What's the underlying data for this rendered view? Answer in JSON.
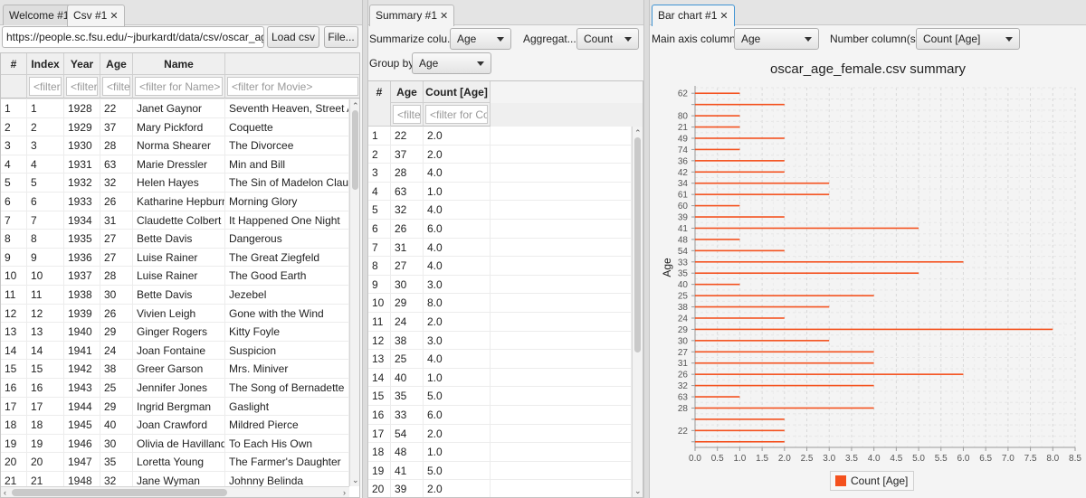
{
  "left": {
    "tabs": [
      {
        "label": "Welcome #1",
        "closable": false
      },
      {
        "label": "Csv #1",
        "closable": true
      }
    ],
    "url": "https://people.sc.fsu.edu/~jburkardt/data/csv/oscar_age_fer",
    "load_button": "Load csv",
    "file_button": "File...",
    "columns": [
      "#",
      "Index",
      "Year",
      "Age",
      "Name",
      ""
    ],
    "filters": [
      "",
      "<filter",
      "<filter",
      "<filte",
      "<filter for Name>",
      "<filter for Movie>"
    ],
    "rows": [
      [
        "1",
        "1",
        "1928",
        "22",
        "Janet Gaynor",
        "Seventh Heaven, Street Ang"
      ],
      [
        "2",
        "2",
        "1929",
        "37",
        "Mary Pickford",
        "Coquette"
      ],
      [
        "3",
        "3",
        "1930",
        "28",
        "Norma Shearer",
        "The Divorcee"
      ],
      [
        "4",
        "4",
        "1931",
        "63",
        "Marie Dressler",
        "Min and Bill"
      ],
      [
        "5",
        "5",
        "1932",
        "32",
        "Helen Hayes",
        "The Sin of Madelon Claudet"
      ],
      [
        "6",
        "6",
        "1933",
        "26",
        "Katharine Hepburn",
        "Morning Glory"
      ],
      [
        "7",
        "7",
        "1934",
        "31",
        "Claudette Colbert",
        "It Happened One Night"
      ],
      [
        "8",
        "8",
        "1935",
        "27",
        "Bette Davis",
        "Dangerous"
      ],
      [
        "9",
        "9",
        "1936",
        "27",
        "Luise Rainer",
        "The Great Ziegfeld"
      ],
      [
        "10",
        "10",
        "1937",
        "28",
        "Luise Rainer",
        "The Good Earth"
      ],
      [
        "11",
        "11",
        "1938",
        "30",
        "Bette Davis",
        "Jezebel"
      ],
      [
        "12",
        "12",
        "1939",
        "26",
        "Vivien Leigh",
        "Gone with the Wind"
      ],
      [
        "13",
        "13",
        "1940",
        "29",
        "Ginger Rogers",
        "Kitty Foyle"
      ],
      [
        "14",
        "14",
        "1941",
        "24",
        "Joan Fontaine",
        "Suspicion"
      ],
      [
        "15",
        "15",
        "1942",
        "38",
        "Greer Garson",
        "Mrs. Miniver"
      ],
      [
        "16",
        "16",
        "1943",
        "25",
        "Jennifer Jones",
        "The Song of Bernadette"
      ],
      [
        "17",
        "17",
        "1944",
        "29",
        "Ingrid Bergman",
        "Gaslight"
      ],
      [
        "18",
        "18",
        "1945",
        "40",
        "Joan Crawford",
        "Mildred Pierce"
      ],
      [
        "19",
        "19",
        "1946",
        "30",
        "Olivia de Havilland",
        "To Each His Own"
      ],
      [
        "20",
        "20",
        "1947",
        "35",
        "Loretta Young",
        "The Farmer's Daughter"
      ],
      [
        "21",
        "21",
        "1948",
        "32",
        "Jane Wyman",
        "Johnny Belinda"
      ]
    ]
  },
  "summary": {
    "tab": "Summary #1",
    "summarize_label": "Summarize colu...",
    "summarize_value": "Age",
    "aggregate_label": "Aggregat...",
    "aggregate_value": "Count",
    "groupby_label": "Group by:",
    "groupby_value": "Age",
    "columns": [
      "#",
      "Age",
      "Count [Age]"
    ],
    "filters": [
      "",
      "<filte",
      "<filter for Cou"
    ],
    "rows": [
      [
        "1",
        "22",
        "2.0"
      ],
      [
        "2",
        "37",
        "2.0"
      ],
      [
        "3",
        "28",
        "4.0"
      ],
      [
        "4",
        "63",
        "1.0"
      ],
      [
        "5",
        "32",
        "4.0"
      ],
      [
        "6",
        "26",
        "6.0"
      ],
      [
        "7",
        "31",
        "4.0"
      ],
      [
        "8",
        "27",
        "4.0"
      ],
      [
        "9",
        "30",
        "3.0"
      ],
      [
        "10",
        "29",
        "8.0"
      ],
      [
        "11",
        "24",
        "2.0"
      ],
      [
        "12",
        "38",
        "3.0"
      ],
      [
        "13",
        "25",
        "4.0"
      ],
      [
        "14",
        "40",
        "1.0"
      ],
      [
        "15",
        "35",
        "5.0"
      ],
      [
        "16",
        "33",
        "6.0"
      ],
      [
        "17",
        "54",
        "2.0"
      ],
      [
        "18",
        "48",
        "1.0"
      ],
      [
        "19",
        "41",
        "5.0"
      ],
      [
        "20",
        "39",
        "2.0"
      ]
    ]
  },
  "chartpane": {
    "tab": "Bar chart #1",
    "main_axis_label": "Main axis column:",
    "main_axis_value": "Age",
    "number_label": "Number column(s):",
    "number_value": "Count [Age]"
  },
  "chart_data": {
    "type": "bar",
    "orientation": "horizontal",
    "title": "oscar_age_female.csv summary",
    "ylabel": "Age",
    "xlabel": "",
    "xlim": [
      0,
      8.5
    ],
    "x_ticks": [
      "0.0",
      "0.5",
      "1.0",
      "1.5",
      "2.0",
      "2.5",
      "3.0",
      "3.5",
      "4.0",
      "4.5",
      "5.0",
      "5.5",
      "6.0",
      "6.5",
      "7.0",
      "7.5",
      "8.0",
      "8.5"
    ],
    "grid": true,
    "legend_position": "bottom",
    "series_color": "#f4511e",
    "series": [
      {
        "name": "Count [Age]"
      }
    ],
    "bars": [
      {
        "category": "62",
        "value": 1
      },
      {
        "category": "",
        "value": 2
      },
      {
        "category": "80",
        "value": 1
      },
      {
        "category": "21",
        "value": 1
      },
      {
        "category": "49",
        "value": 2
      },
      {
        "category": "74",
        "value": 1
      },
      {
        "category": "36",
        "value": 2
      },
      {
        "category": "42",
        "value": 2
      },
      {
        "category": "34",
        "value": 3
      },
      {
        "category": "61",
        "value": 3
      },
      {
        "category": "60",
        "value": 1
      },
      {
        "category": "39",
        "value": 2
      },
      {
        "category": "41",
        "value": 5
      },
      {
        "category": "48",
        "value": 1
      },
      {
        "category": "54",
        "value": 2
      },
      {
        "category": "33",
        "value": 6
      },
      {
        "category": "35",
        "value": 5
      },
      {
        "category": "40",
        "value": 1
      },
      {
        "category": "25",
        "value": 4
      },
      {
        "category": "38",
        "value": 3
      },
      {
        "category": "24",
        "value": 2
      },
      {
        "category": "29",
        "value": 8
      },
      {
        "category": "30",
        "value": 3
      },
      {
        "category": "27",
        "value": 4
      },
      {
        "category": "31",
        "value": 4
      },
      {
        "category": "26",
        "value": 6
      },
      {
        "category": "32",
        "value": 4
      },
      {
        "category": "63",
        "value": 1
      },
      {
        "category": "28",
        "value": 4
      },
      {
        "category": "",
        "value": 2
      },
      {
        "category": "22",
        "value": 2
      },
      {
        "category": "",
        "value": 2
      }
    ]
  }
}
